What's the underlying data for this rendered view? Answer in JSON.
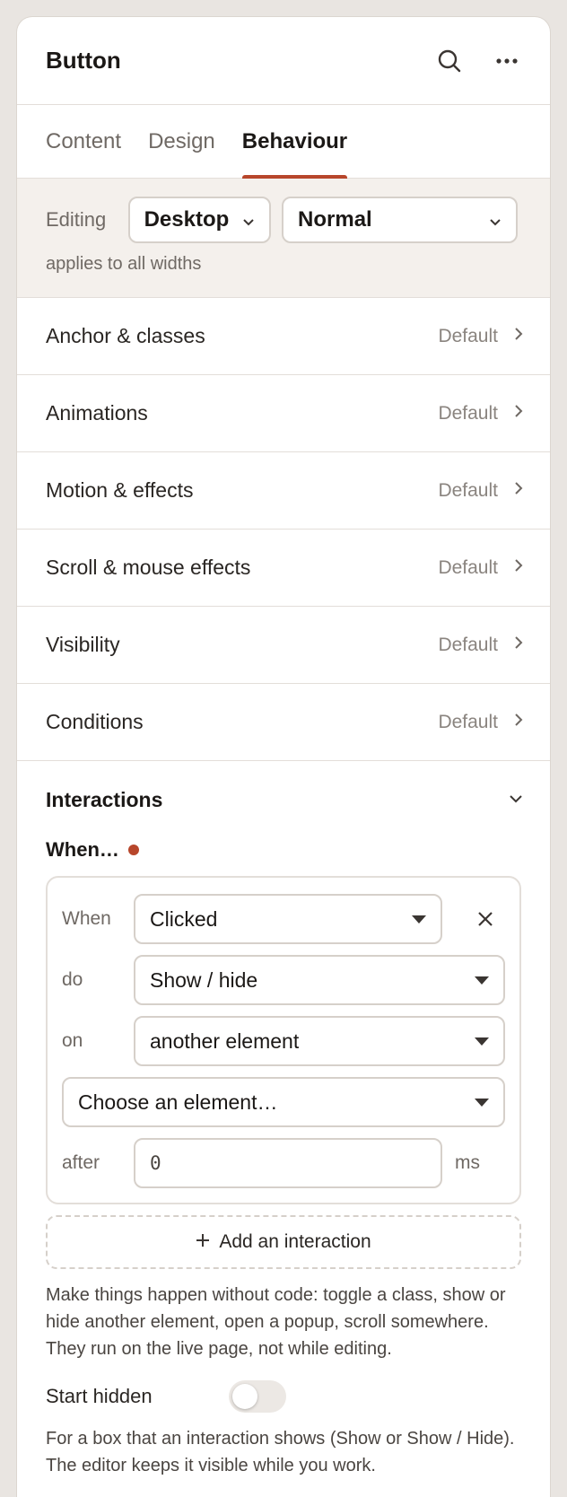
{
  "header": {
    "title": "Button"
  },
  "tabs": [
    {
      "label": "Content"
    },
    {
      "label": "Design"
    },
    {
      "label": "Behaviour"
    }
  ],
  "editing": {
    "label": "Editing",
    "device": "Desktop",
    "state": "Normal",
    "note": "applies to all widths"
  },
  "sections": [
    {
      "label": "Anchor & classes",
      "value": "Default"
    },
    {
      "label": "Animations",
      "value": "Default"
    },
    {
      "label": "Motion & effects",
      "value": "Default"
    },
    {
      "label": "Scroll & mouse effects",
      "value": "Default"
    },
    {
      "label": "Visibility",
      "value": "Default"
    },
    {
      "label": "Conditions",
      "value": "Default"
    }
  ],
  "interactions": {
    "title": "Interactions",
    "when_heading": "When…",
    "rule": {
      "when_label": "When",
      "when_value": "Clicked",
      "do_label": "do",
      "do_value": "Show / hide",
      "on_label": "on",
      "on_value": "another element",
      "element_placeholder": "Choose an element…",
      "after_label": "after",
      "after_value": "0",
      "after_unit": "ms"
    },
    "add_label": "Add an interaction",
    "help": "Make things happen without code: toggle a class, show or hide another element, open a popup, scroll somewhere. They run on the live page, not while editing.",
    "start_hidden_label": "Start hidden",
    "start_hidden_on": false,
    "footnote": "For a box that an interaction shows (Show or Show / Hide). The editor keeps it visible while you work."
  },
  "colors": {
    "accent": "#b7462b",
    "panel": "#ffffff",
    "background": "#e9e5e1"
  }
}
